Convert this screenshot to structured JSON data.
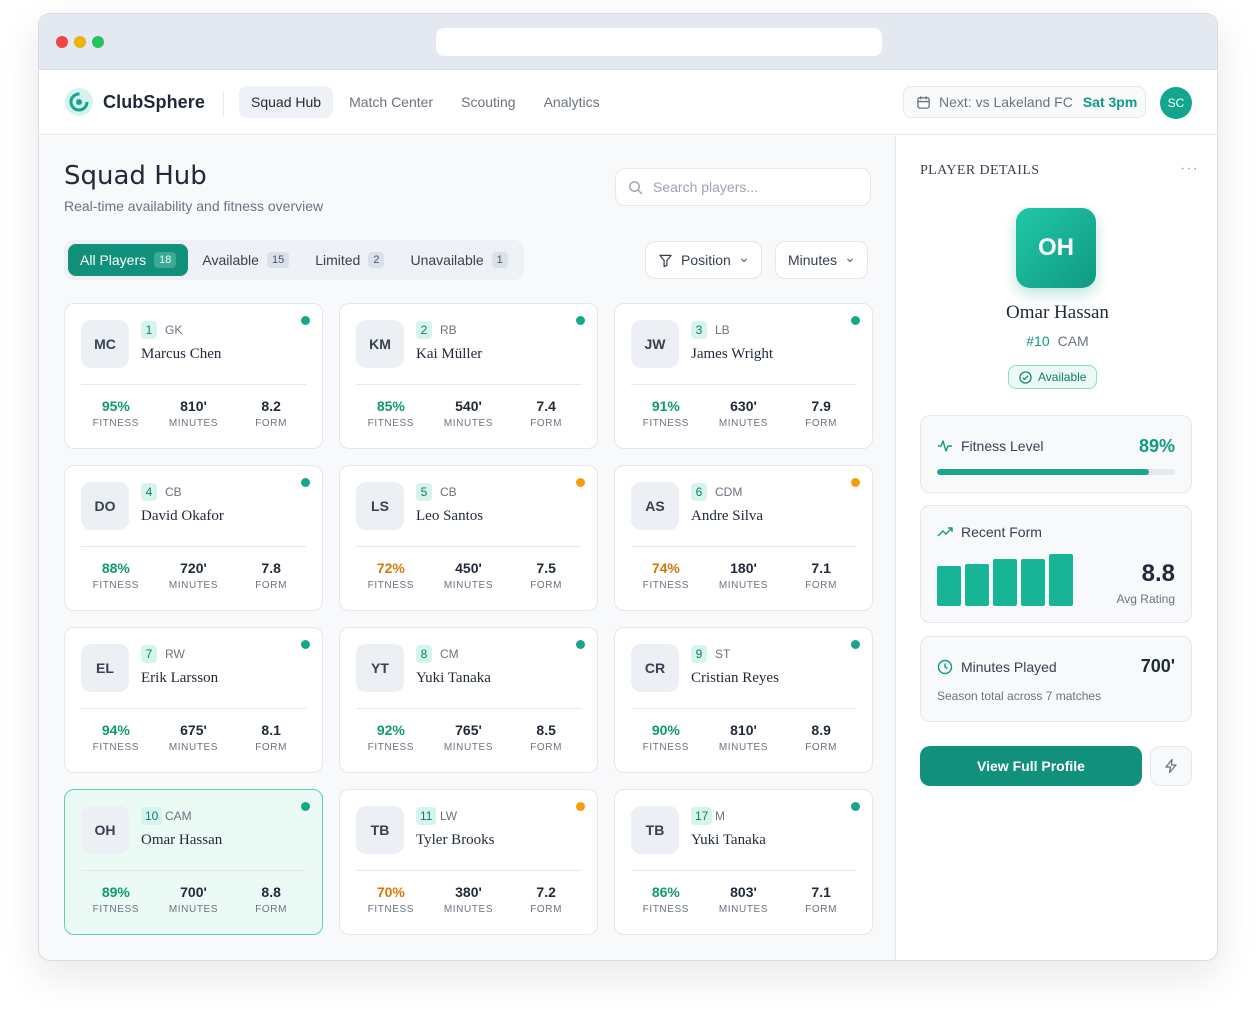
{
  "app": {
    "name": "ClubSphere"
  },
  "nav": {
    "items": [
      "Squad Hub",
      "Match Center",
      "Scouting",
      "Analytics"
    ],
    "active": 0
  },
  "next_match": {
    "label": "Next: vs Lakeland FC",
    "when": "Sat 3pm"
  },
  "user": {
    "initials": "SC"
  },
  "page": {
    "title": "Squad Hub",
    "subtitle": "Real-time availability and fitness overview"
  },
  "search": {
    "placeholder": "Search players..."
  },
  "filters": [
    {
      "label": "All Players",
      "count": "18"
    },
    {
      "label": "Available",
      "count": "15"
    },
    {
      "label": "Limited",
      "count": "2"
    },
    {
      "label": "Unavailable",
      "count": "1"
    }
  ],
  "dropdowns": {
    "position": "Position",
    "minutes": "Minutes"
  },
  "stat_labels": {
    "fitness": "FITNESS",
    "minutes": "MINUTES",
    "form": "FORM"
  },
  "players": [
    {
      "initials": "MC",
      "number": "1",
      "position": "GK",
      "name": "Marcus Chen",
      "fitness": "95%",
      "minutes": "810'",
      "form": "8.2",
      "status": "ok",
      "level": "good"
    },
    {
      "initials": "KM",
      "number": "2",
      "position": "RB",
      "name": "Kai Müller",
      "fitness": "85%",
      "minutes": "540'",
      "form": "7.4",
      "status": "ok",
      "level": "good"
    },
    {
      "initials": "JW",
      "number": "3",
      "position": "LB",
      "name": "James Wright",
      "fitness": "91%",
      "minutes": "630'",
      "form": "7.9",
      "status": "ok",
      "level": "good"
    },
    {
      "initials": "DO",
      "number": "4",
      "position": "CB",
      "name": "David Okafor",
      "fitness": "88%",
      "minutes": "720'",
      "form": "7.8",
      "status": "ok",
      "level": "good"
    },
    {
      "initials": "LS",
      "number": "5",
      "position": "CB",
      "name": "Leo Santos",
      "fitness": "72%",
      "minutes": "450'",
      "form": "7.5",
      "status": "warn",
      "level": "mid"
    },
    {
      "initials": "AS",
      "number": "6",
      "position": "CDM",
      "name": "Andre Silva",
      "fitness": "74%",
      "minutes": "180'",
      "form": "7.1",
      "status": "warn",
      "level": "mid"
    },
    {
      "initials": "EL",
      "number": "7",
      "position": "RW",
      "name": "Erik Larsson",
      "fitness": "94%",
      "minutes": "675'",
      "form": "8.1",
      "status": "ok",
      "level": "good"
    },
    {
      "initials": "YT",
      "number": "8",
      "position": "CM",
      "name": "Yuki Tanaka",
      "fitness": "92%",
      "minutes": "765'",
      "form": "8.5",
      "status": "ok",
      "level": "good"
    },
    {
      "initials": "CR",
      "number": "9",
      "position": "ST",
      "name": "Cristian Reyes",
      "fitness": "90%",
      "minutes": "810'",
      "form": "8.9",
      "status": "ok",
      "level": "good"
    },
    {
      "initials": "OH",
      "number": "10",
      "position": "CAM",
      "name": "Omar Hassan",
      "fitness": "89%",
      "minutes": "700'",
      "form": "8.8",
      "status": "ok",
      "level": "good",
      "selected": true
    },
    {
      "initials": "TB",
      "number": "11",
      "position": "LW",
      "name": "Tyler Brooks",
      "fitness": "70%",
      "minutes": "380'",
      "form": "7.2",
      "status": "warn",
      "level": "mid"
    },
    {
      "initials": "TB",
      "number": "17",
      "position": "M",
      "name": "Yuki Tanaka",
      "fitness": "86%",
      "minutes": "803'",
      "form": "7.1",
      "status": "ok",
      "level": "good"
    }
  ],
  "details": {
    "heading": "PLAYER DETAILS",
    "more": "···",
    "initials": "OH",
    "name": "Omar Hassan",
    "number": "#10",
    "position": "CAM",
    "status": "Available",
    "fitness_label": "Fitness Level",
    "fitness_value": "89%",
    "fitness_fraction": 0.89,
    "form_label": "Recent Form",
    "form_value": "8.8",
    "form_caption": "Avg Rating",
    "form_bars": [
      7.6,
      8.0,
      8.9,
      8.8,
      9.8
    ],
    "minutes_label": "Minutes Played",
    "minutes_value": "700'",
    "minutes_note": "Season total across 7 matches",
    "cta": "View Full Profile"
  },
  "colors": {
    "accent": "#11907c",
    "available": "#16a78a",
    "limited": "#f59e0b"
  }
}
